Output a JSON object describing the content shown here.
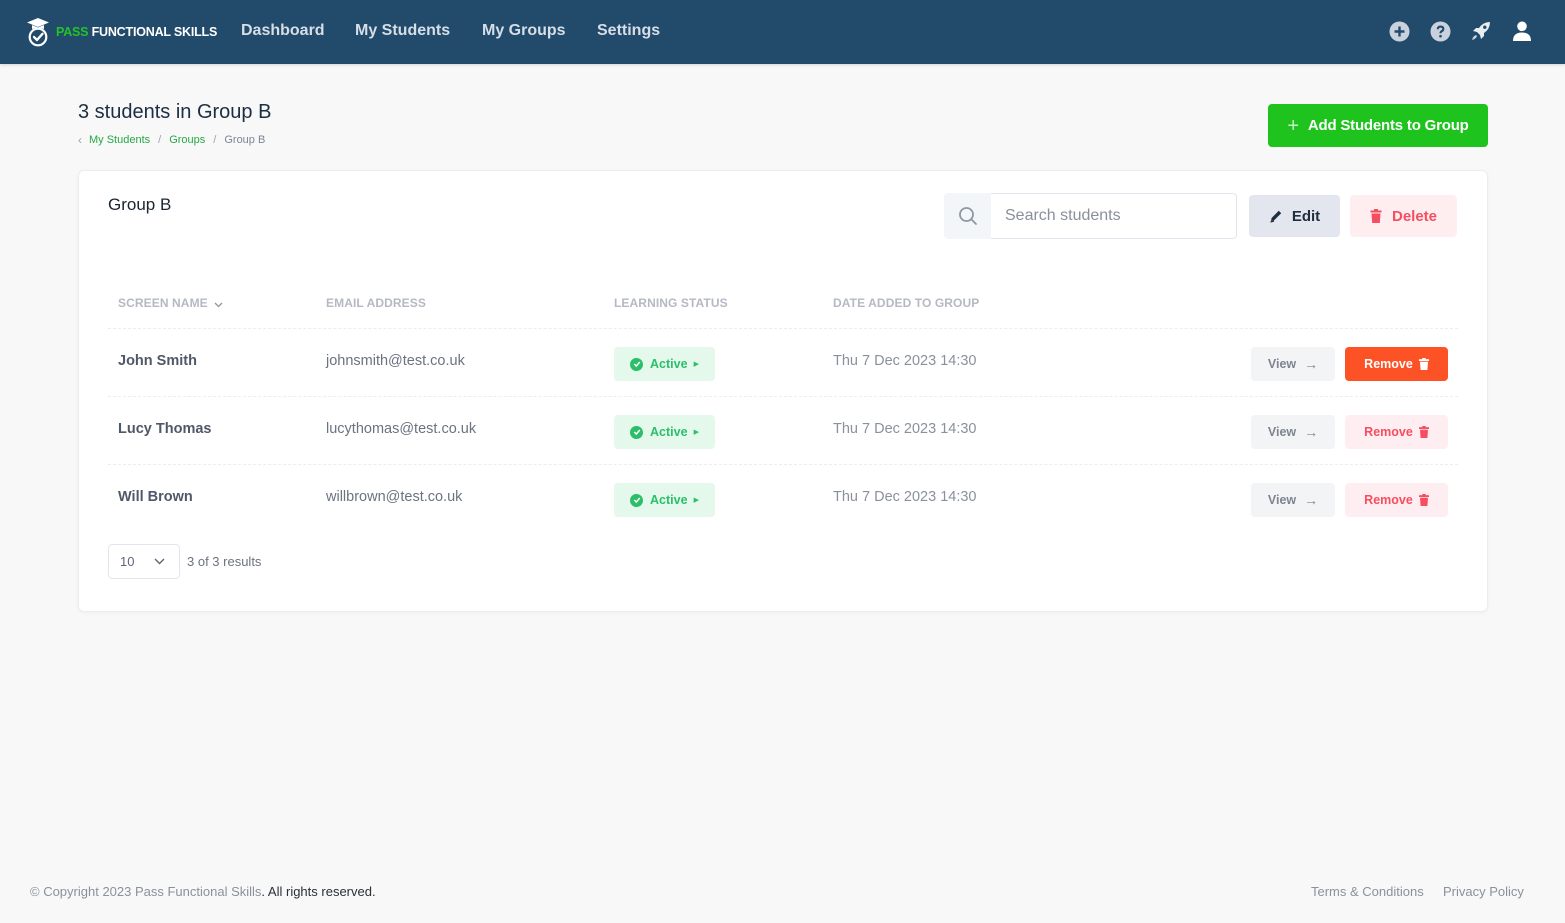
{
  "brand": {
    "pass": "PASS",
    "rest": "FUNCTIONAL SKILLS"
  },
  "nav": {
    "items": [
      {
        "label": "Dashboard"
      },
      {
        "label": "My Students"
      },
      {
        "label": "My Groups"
      },
      {
        "label": "Settings"
      }
    ],
    "icons": [
      "plus-circle-icon",
      "help-icon",
      "rocket-icon",
      "user-icon"
    ]
  },
  "header": {
    "title": "3 students in Group B",
    "breadcrumb": [
      "My Students",
      "Groups",
      "Group B"
    ],
    "add_button": "Add Students to Group"
  },
  "card": {
    "title": "Group B",
    "search_placeholder": "Search students",
    "edit_label": "Edit",
    "delete_label": "Delete"
  },
  "table": {
    "columns": [
      "Screen Name",
      "Email Address",
      "Learning Status",
      "Date Added to Group"
    ],
    "rows": [
      {
        "name": "John Smith",
        "email": "johnsmith@test.co.uk",
        "status": "Active",
        "date": "Thu 7 Dec 2023 14:30",
        "view": "View",
        "remove": "Remove"
      },
      {
        "name": "Lucy Thomas",
        "email": "lucythomas@test.co.uk",
        "status": "Active",
        "date": "Thu 7 Dec 2023 14:30",
        "view": "View",
        "remove": "Remove"
      },
      {
        "name": "Will Brown",
        "email": "willbrown@test.co.uk",
        "status": "Active",
        "date": "Thu 7 Dec 2023 14:30",
        "view": "View",
        "remove": "Remove"
      }
    ]
  },
  "pagination": {
    "page_size": "10",
    "results": "3 of 3 results"
  },
  "footer": {
    "copy_prefix": "© Copyright 2023 Pass Functional Skills",
    "copy_suffix": ". All rights reserved.",
    "terms": "Terms & Conditions",
    "privacy": "Privacy Policy"
  },
  "colors": {
    "nav_bg": "#224a6b",
    "brand_green": "#1ec31e",
    "danger": "#f64e60",
    "remove_solid": "#fd5126",
    "status_green": "#2cbf6a"
  }
}
